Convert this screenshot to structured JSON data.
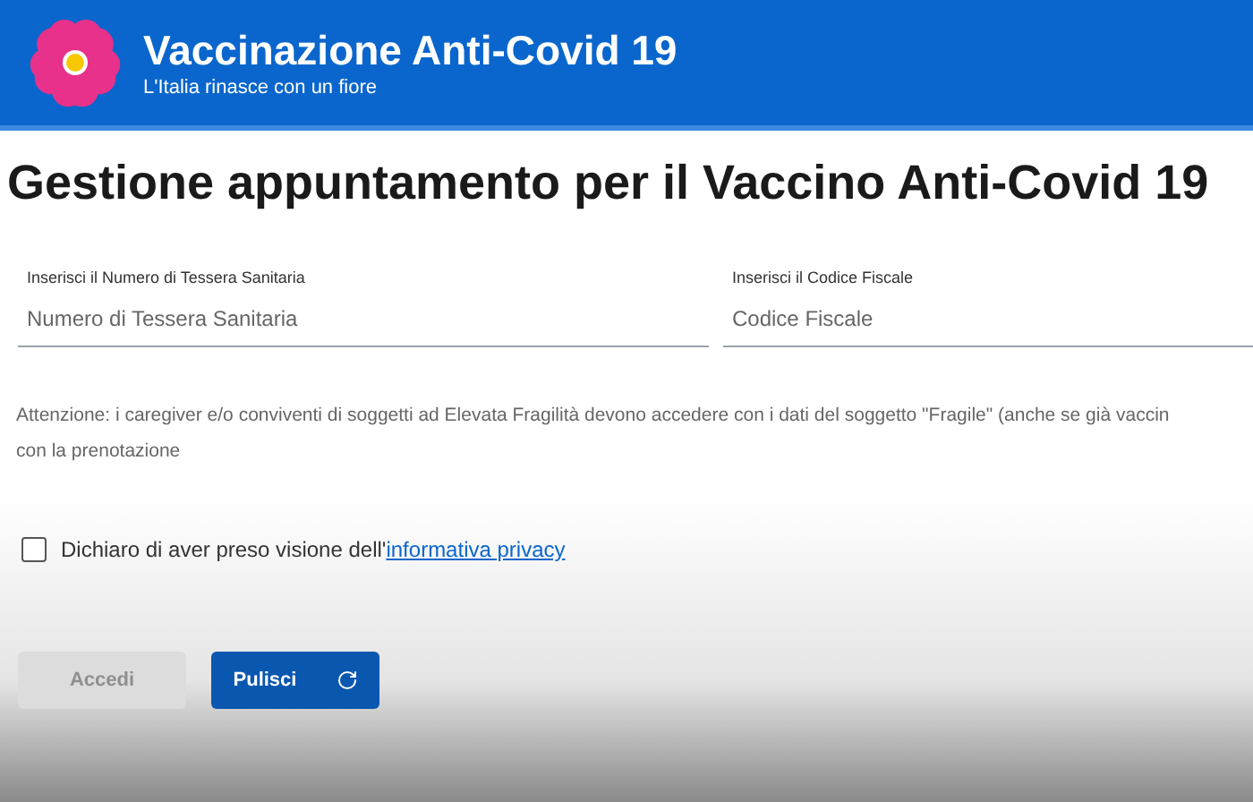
{
  "header": {
    "title": "Vaccinazione Anti-Covid 19",
    "subtitle": "L'Italia rinasce con un fiore"
  },
  "page_title": "Gestione appuntamento per il Vaccino Anti-Covid 19",
  "fields": [
    {
      "label": "Inserisci il Numero di Tessera Sanitaria",
      "placeholder": "Numero di Tessera Sanitaria"
    },
    {
      "label": "Inserisci il Codice Fiscale",
      "placeholder": "Codice Fiscale"
    }
  ],
  "notice_lines": [
    "Attenzione: i caregiver e/o conviventi di soggetti ad Elevata Fragilità devono accedere con i dati del soggetto \"Fragile\" (anche se già vaccin",
    "con la prenotazione"
  ],
  "privacy": {
    "checked": false,
    "text": "Dichiaro di aver preso visione dell'",
    "link": "informativa privacy"
  },
  "buttons": [
    {
      "label": "Accedi",
      "disabled": true
    },
    {
      "label": "Pulisci",
      "disabled": false
    }
  ]
}
